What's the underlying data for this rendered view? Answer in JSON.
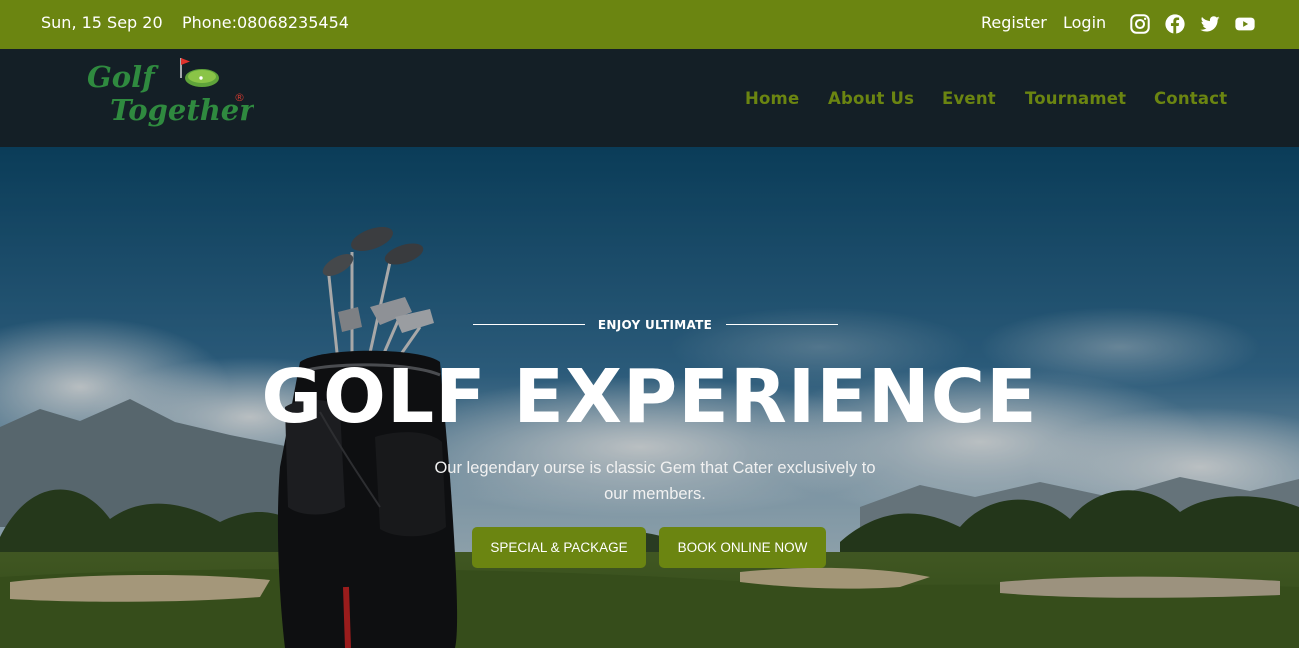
{
  "topbar": {
    "date": "Sun, 15 Sep 20",
    "phone": "Phone:08068235454",
    "register": "Register",
    "login": "Login",
    "socials": [
      "instagram-icon",
      "facebook-icon",
      "twitter-icon",
      "youtube-icon"
    ]
  },
  "brand": {
    "logo_line1": "Golf",
    "logo_line2": "Together",
    "registered_mark": "®"
  },
  "nav": {
    "home": "Home",
    "about": "About Us",
    "event": "Event",
    "tournament": "Tournamet",
    "contact": "Contact"
  },
  "hero": {
    "eyebrow": "ENJOY ULTIMATE",
    "headline": "GOLF EXPERIENCE",
    "subtitle": "Our legendary ourse is classic Gem that Cater exclusively to our members.",
    "button_packages": "SPECIAL & PACKAGE",
    "button_book": "BOOK ONLINE NOW"
  },
  "colors": {
    "accent_green": "#6b8511",
    "nav_dark": "#141f26",
    "logo_green": "#2f8a3f"
  }
}
